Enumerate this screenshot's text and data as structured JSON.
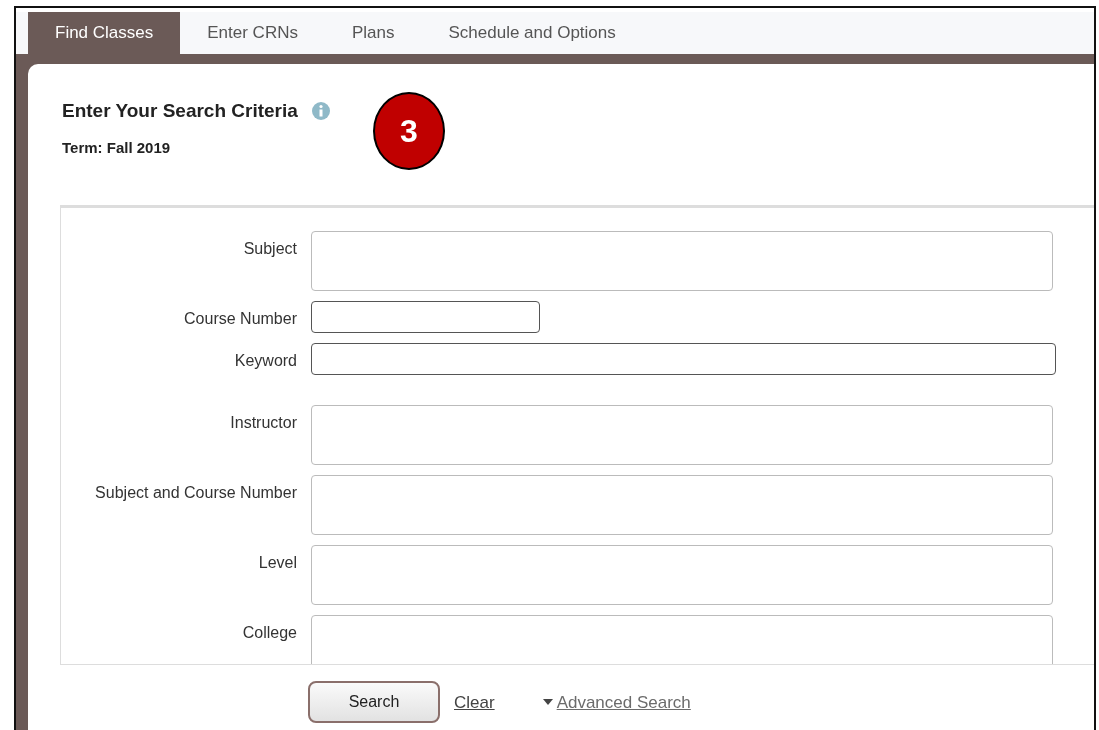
{
  "tabs": [
    {
      "label": "Find Classes",
      "selected": true
    },
    {
      "label": "Enter CRNs",
      "selected": false
    },
    {
      "label": "Plans",
      "selected": false
    },
    {
      "label": "Schedule and Options",
      "selected": false
    }
  ],
  "heading": "Enter Your Search Criteria",
  "term": "Term: Fall 2019",
  "callout": {
    "number": "3"
  },
  "fields": [
    {
      "label": "Subject",
      "kind": "tall"
    },
    {
      "label": "Course Number",
      "kind": "short"
    },
    {
      "label": "Keyword",
      "kind": "line"
    },
    {
      "label": "Instructor",
      "kind": "tall"
    },
    {
      "label": "Subject and Course Number",
      "kind": "tall"
    },
    {
      "label": "Level",
      "kind": "tall"
    },
    {
      "label": "College",
      "kind": "tall"
    }
  ],
  "buttons": {
    "search": "Search",
    "clear": "Clear",
    "advanced": "Advanced Search"
  }
}
